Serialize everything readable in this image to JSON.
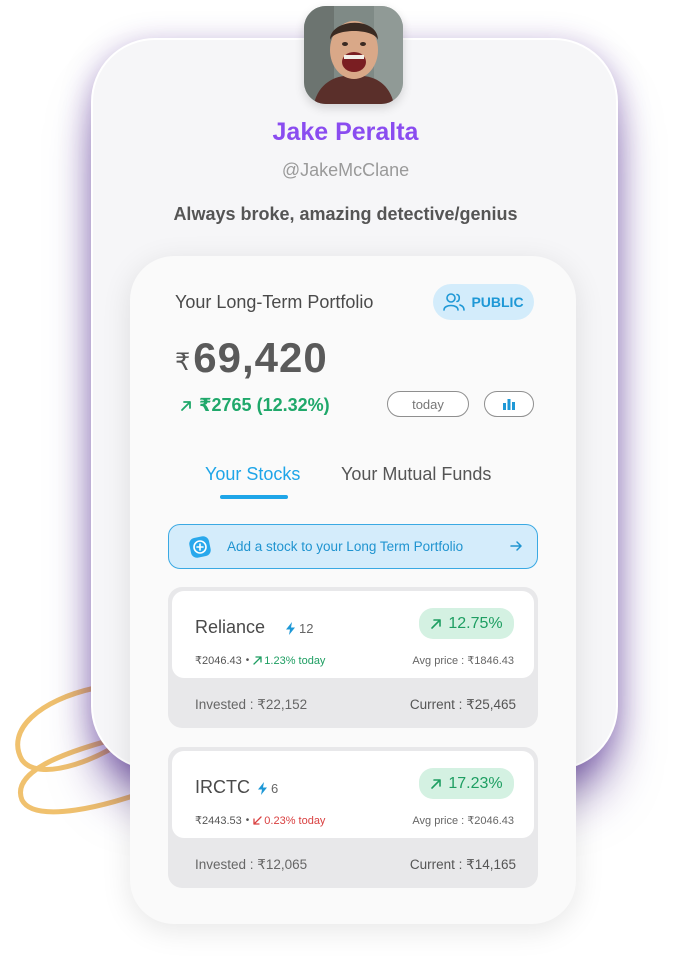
{
  "profile": {
    "name": "Jake Peralta",
    "handle": "@JakeMcClane",
    "bio": "Always broke, amazing detective/genius"
  },
  "portfolio": {
    "title": "Your Long-Term Portfolio",
    "visibility_label": "PUBLIC",
    "currency_symbol": "₹",
    "total_value": "69,420",
    "change_text": "₹2765 (12.32%)",
    "period_label": "today",
    "tabs": [
      {
        "label": "Your Stocks",
        "active": true
      },
      {
        "label": "Your Mutual Funds",
        "active": false
      }
    ],
    "add_stock_label": "Add a stock to your Long Term Portfolio",
    "stocks": [
      {
        "name": "Reliance",
        "count": "12",
        "return_pct": "12.75%",
        "price": "₹2046.43",
        "today_change": "1.23% today",
        "today_direction": "up",
        "avg_price": "Avg price : ₹1846.43",
        "invested": "Invested : ₹22,152",
        "current": "Current : ₹25,465"
      },
      {
        "name": "IRCTC",
        "count": "6",
        "return_pct": "17.23%",
        "price": "₹2443.53",
        "today_change": "0.23% today",
        "today_direction": "down",
        "avg_price": "Avg price : ₹2046.43",
        "invested": "Invested : ₹12,065",
        "current": "Current : ₹14,165"
      }
    ]
  },
  "colors": {
    "accent_purple": "#8a4cf0",
    "accent_blue": "#1ea5e8",
    "positive_green": "#1e9e62",
    "negative_red": "#d94040"
  }
}
